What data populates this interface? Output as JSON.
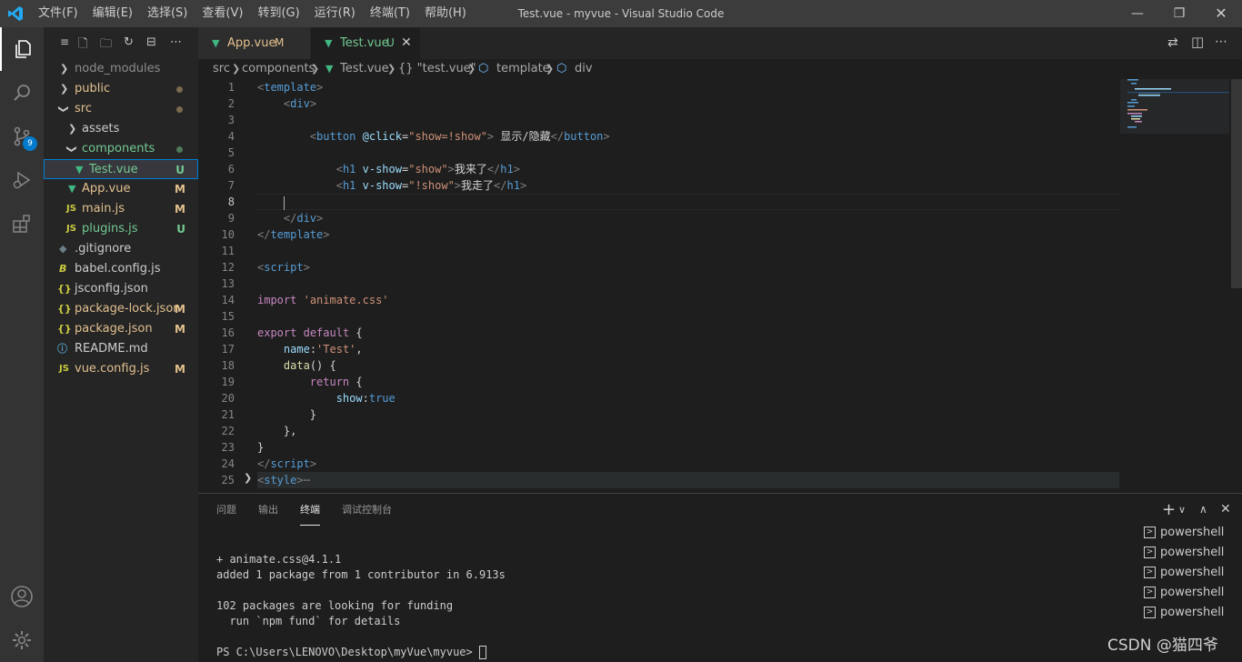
{
  "window": {
    "title": "Test.vue - myvue - Visual Studio Code",
    "menu": [
      "文件(F)",
      "编辑(E)",
      "选择(S)",
      "查看(V)",
      "转到(G)",
      "运行(R)",
      "终端(T)",
      "帮助(H)"
    ]
  },
  "activity_bar": {
    "scm_badge": "9"
  },
  "explorer": {
    "items": [
      {
        "label": "node_modules",
        "status": ""
      },
      {
        "label": "public",
        "status": ""
      },
      {
        "label": "src",
        "status": ""
      },
      {
        "label": "assets",
        "status": ""
      },
      {
        "label": "components",
        "status": ""
      },
      {
        "label": "Test.vue",
        "status": "U"
      },
      {
        "label": "App.vue",
        "status": "M"
      },
      {
        "label": "main.js",
        "status": "M"
      },
      {
        "label": "plugins.js",
        "status": "U"
      },
      {
        "label": ".gitignore",
        "status": ""
      },
      {
        "label": "babel.config.js",
        "status": ""
      },
      {
        "label": "jsconfig.json",
        "status": ""
      },
      {
        "label": "package-lock.json",
        "status": "M"
      },
      {
        "label": "package.json",
        "status": "M"
      },
      {
        "label": "README.md",
        "status": ""
      },
      {
        "label": "vue.config.js",
        "status": "M"
      }
    ]
  },
  "tabs": [
    {
      "label": "App.vue",
      "status": "M"
    },
    {
      "label": "Test.vue",
      "status": "U"
    }
  ],
  "breadcrumbs": [
    "src",
    "components",
    "Test.vue",
    "{} \"test.vue\"",
    "template",
    "div"
  ],
  "editor": {
    "line_numbers": [
      "1",
      "2",
      "3",
      "4",
      "5",
      "6",
      "7",
      "8",
      "9",
      "10",
      "11",
      "12",
      "13",
      "14",
      "15",
      "16",
      "17",
      "18",
      "19",
      "20",
      "21",
      "22",
      "23",
      "24",
      "25"
    ],
    "current_line": "8"
  },
  "panel": {
    "tabs": [
      "问题",
      "输出",
      "终端",
      "调试控制台"
    ],
    "active_tab": "终端",
    "terminal_lines": [
      "+ animate.css@4.1.1",
      "added 1 package from 1 contributor in 6.913s",
      "",
      "102 packages are looking for funding",
      "  run `npm fund` for details",
      "",
      "PS C:\\Users\\LENOVO\\Desktop\\myVue\\myvue> "
    ],
    "sessions": [
      "powershell",
      "powershell",
      "powershell",
      "powershell",
      "powershell"
    ]
  },
  "watermark": "CSDN @猫四爷"
}
